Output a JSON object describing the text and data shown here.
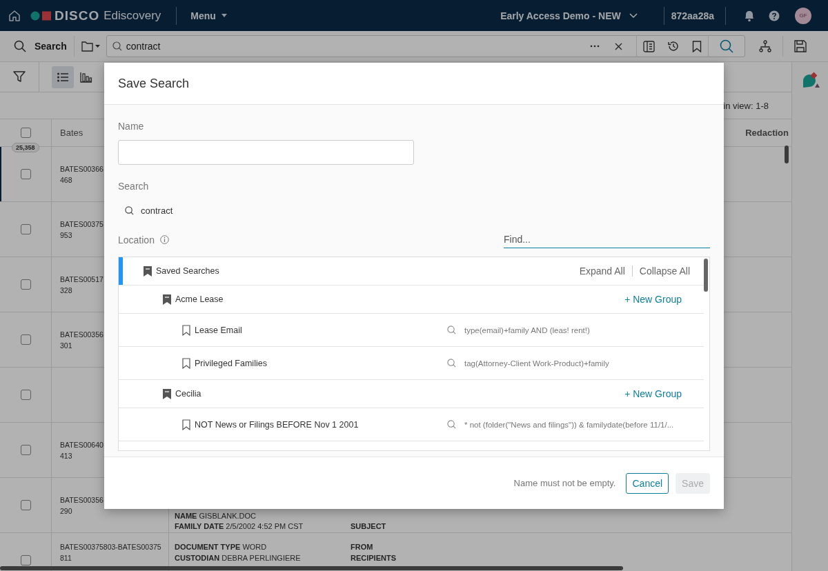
{
  "header": {
    "logo": "DISCO",
    "product": "Ediscovery",
    "menu": "Menu",
    "workspace": "Early Access Demo - NEW",
    "build": "872aa28a",
    "avatar": "GF"
  },
  "toolbar": {
    "search_label": "Search",
    "query": "contract"
  },
  "view_toggle": [
    {
      "kind": "list",
      "selected": true
    },
    {
      "kind": "chart",
      "selected": false
    }
  ],
  "in_view": "in view: 1-8",
  "table": {
    "columns": [
      "Bates",
      "Redaction"
    ],
    "all_checked": false,
    "count": "25,358",
    "rows": [
      {
        "selected": true,
        "checked": false,
        "bates": [
          "BATES00366",
          "468"
        ]
      },
      {
        "selected": false,
        "checked": false,
        "bates": [
          "BATES00375",
          "953"
        ]
      },
      {
        "selected": false,
        "checked": false,
        "bates": [
          "BATES00517",
          "328"
        ]
      },
      {
        "selected": false,
        "checked": false,
        "bates": [
          "BATES00356",
          "301"
        ]
      },
      {
        "selected": false,
        "checked": false
      },
      {
        "selected": false,
        "checked": false,
        "bates": [
          "BATES00640",
          "413"
        ]
      },
      {
        "selected": false,
        "checked": false,
        "bates": [
          "BATES00356",
          "290"
        ],
        "meta_left": [
          {
            "label": "NAME",
            "value": "GISBLANK.DOC"
          },
          {
            "label": "FAMILY DATE",
            "value": "2/5/2002 4:52 PM CST"
          }
        ],
        "meta_right": [
          {
            "label": "SUBJECT"
          }
        ]
      },
      {
        "selected": false,
        "checked": false,
        "bates": [
          "BATES00375803-BATES00375",
          "811"
        ],
        "meta_left": [
          {
            "label": "DOCUMENT TYPE",
            "value": "WORD"
          },
          {
            "label": "CUSTODIAN",
            "value": "DEBRA PERLINGIERE"
          }
        ],
        "meta_right": [
          {
            "label": "FROM"
          },
          {
            "label": "RECIPIENTS"
          }
        ]
      }
    ]
  },
  "modal": {
    "title": "Save Search",
    "name_label": "Name",
    "search_label": "Search",
    "search_query": "contract",
    "location_label": "Location",
    "find_placeholder": "Find...",
    "tree": [
      {
        "kind": "root",
        "label": "Saved Searches",
        "selected": true,
        "actions": [
          "Expand All",
          "Collapse All"
        ],
        "children": [
          {
            "kind": "group",
            "label": "Acme Lease",
            "selected": false,
            "action": "+ New Group",
            "children": [
              {
                "kind": "search",
                "label": "Lease Email",
                "selected": false,
                "query": "type(email)+family AND (leas! rent!)"
              },
              {
                "kind": "search",
                "label": "Privileged Families",
                "selected": false,
                "query": "tag(Attorney-Client Work-Product)+family"
              }
            ]
          },
          {
            "kind": "group",
            "label": "Cecilia",
            "selected": false,
            "action": "+ New Group",
            "children": [
              {
                "kind": "search",
                "label": "NOT News or Filings BEFORE Nov 1 2001",
                "selected": false,
                "query": "* not (folder(\"News and filings\")) & familydate(before 11/1/..."
              }
            ]
          }
        ]
      }
    ],
    "message": "Name must not be empty.",
    "buttons": [
      {
        "label": "Cancel",
        "kind": "secondary",
        "disabled": false
      },
      {
        "label": "Save",
        "kind": "primary",
        "disabled": true
      }
    ]
  }
}
